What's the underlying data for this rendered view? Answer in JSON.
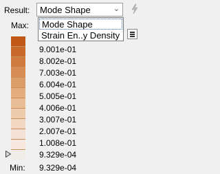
{
  "result": {
    "label": "Result:",
    "selected": "Mode Shape",
    "options": [
      "Mode Shape",
      "Strain En..y Density"
    ]
  },
  "max_label": "Max:",
  "min_label": "Min:",
  "min_value": "9.329e-04",
  "legend": {
    "colors": [
      "#c05818",
      "#c76a2c",
      "#cf7b3f",
      "#d68c53",
      "#dc9d68",
      "#e3ad7e",
      "#e9bd95",
      "#eecbac",
      "#f2d7c2",
      "#f5e2d6",
      "#f6e7df",
      "#f0ece8"
    ],
    "values": [
      "9.001e-01",
      "8.002e-01",
      "7.003e-01",
      "6.004e-01",
      "5.005e-01",
      "4.006e-01",
      "3.007e-01",
      "2.007e-01",
      "1.008e-01",
      "9.329e-04"
    ]
  },
  "icons": {
    "lightning": "lightning-icon",
    "combo_arrow": "chevron-down-icon",
    "menu": "menu-icon",
    "pointer": "triangle-pointer-icon"
  }
}
